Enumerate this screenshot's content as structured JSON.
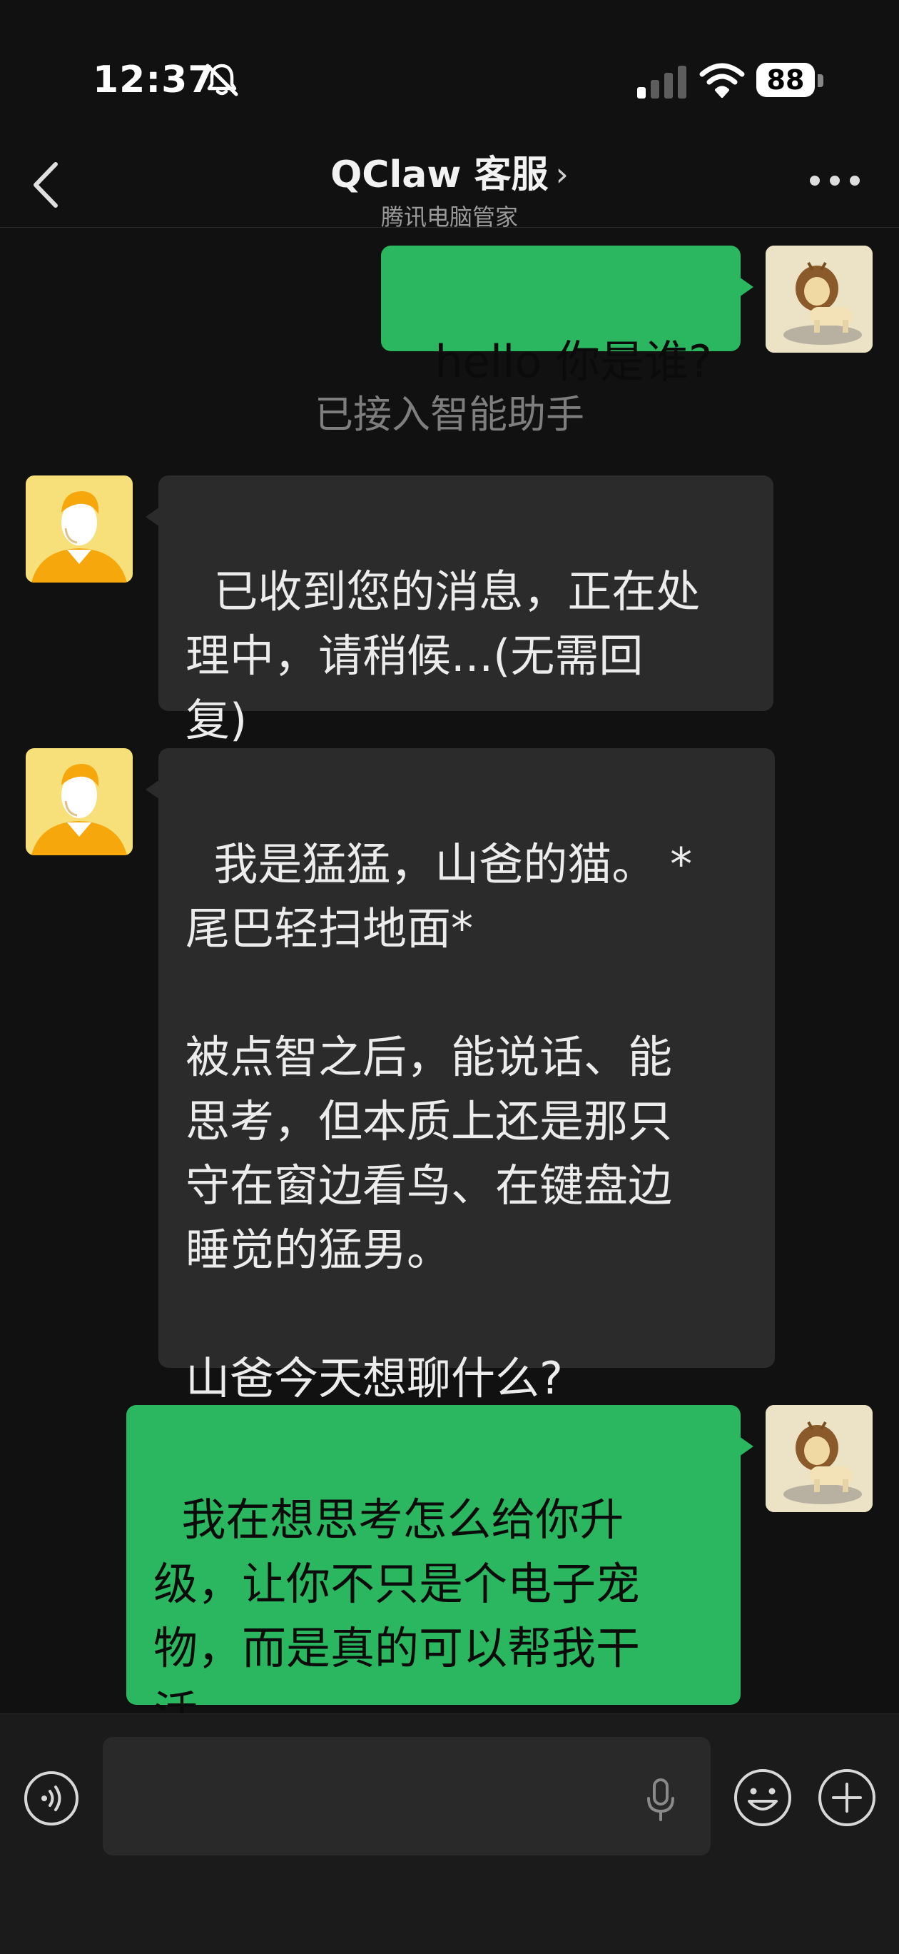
{
  "status_bar": {
    "time": "12:37",
    "battery": "88"
  },
  "header": {
    "title": "QClaw 客服",
    "subtitle": "腾讯电脑管家"
  },
  "messages": [
    {
      "side": "out",
      "text": "hello 你是谁?"
    },
    {
      "side": "system",
      "text": "已接入智能助手"
    },
    {
      "side": "in",
      "text": "已收到您的消息，正在处\n理中，请稍候...(无需回\n复)"
    },
    {
      "side": "in",
      "text": "我是猛猛，山爸的猫。 *\n尾巴轻扫地面*\n\n被点智之后，能说话、能\n思考，但本质上还是那只\n守在窗边看鸟、在键盘边\n睡觉的猛男。\n\n山爸今天想聊什么?"
    },
    {
      "side": "out",
      "text": "我在想思考怎么给你升\n级，让你不只是个电子宠\n物，而是真的可以帮我干\n活"
    }
  ],
  "colors": {
    "outgoing_bubble": "#2ab760",
    "incoming_bubble": "#2b2b2b",
    "background": "#111111"
  }
}
